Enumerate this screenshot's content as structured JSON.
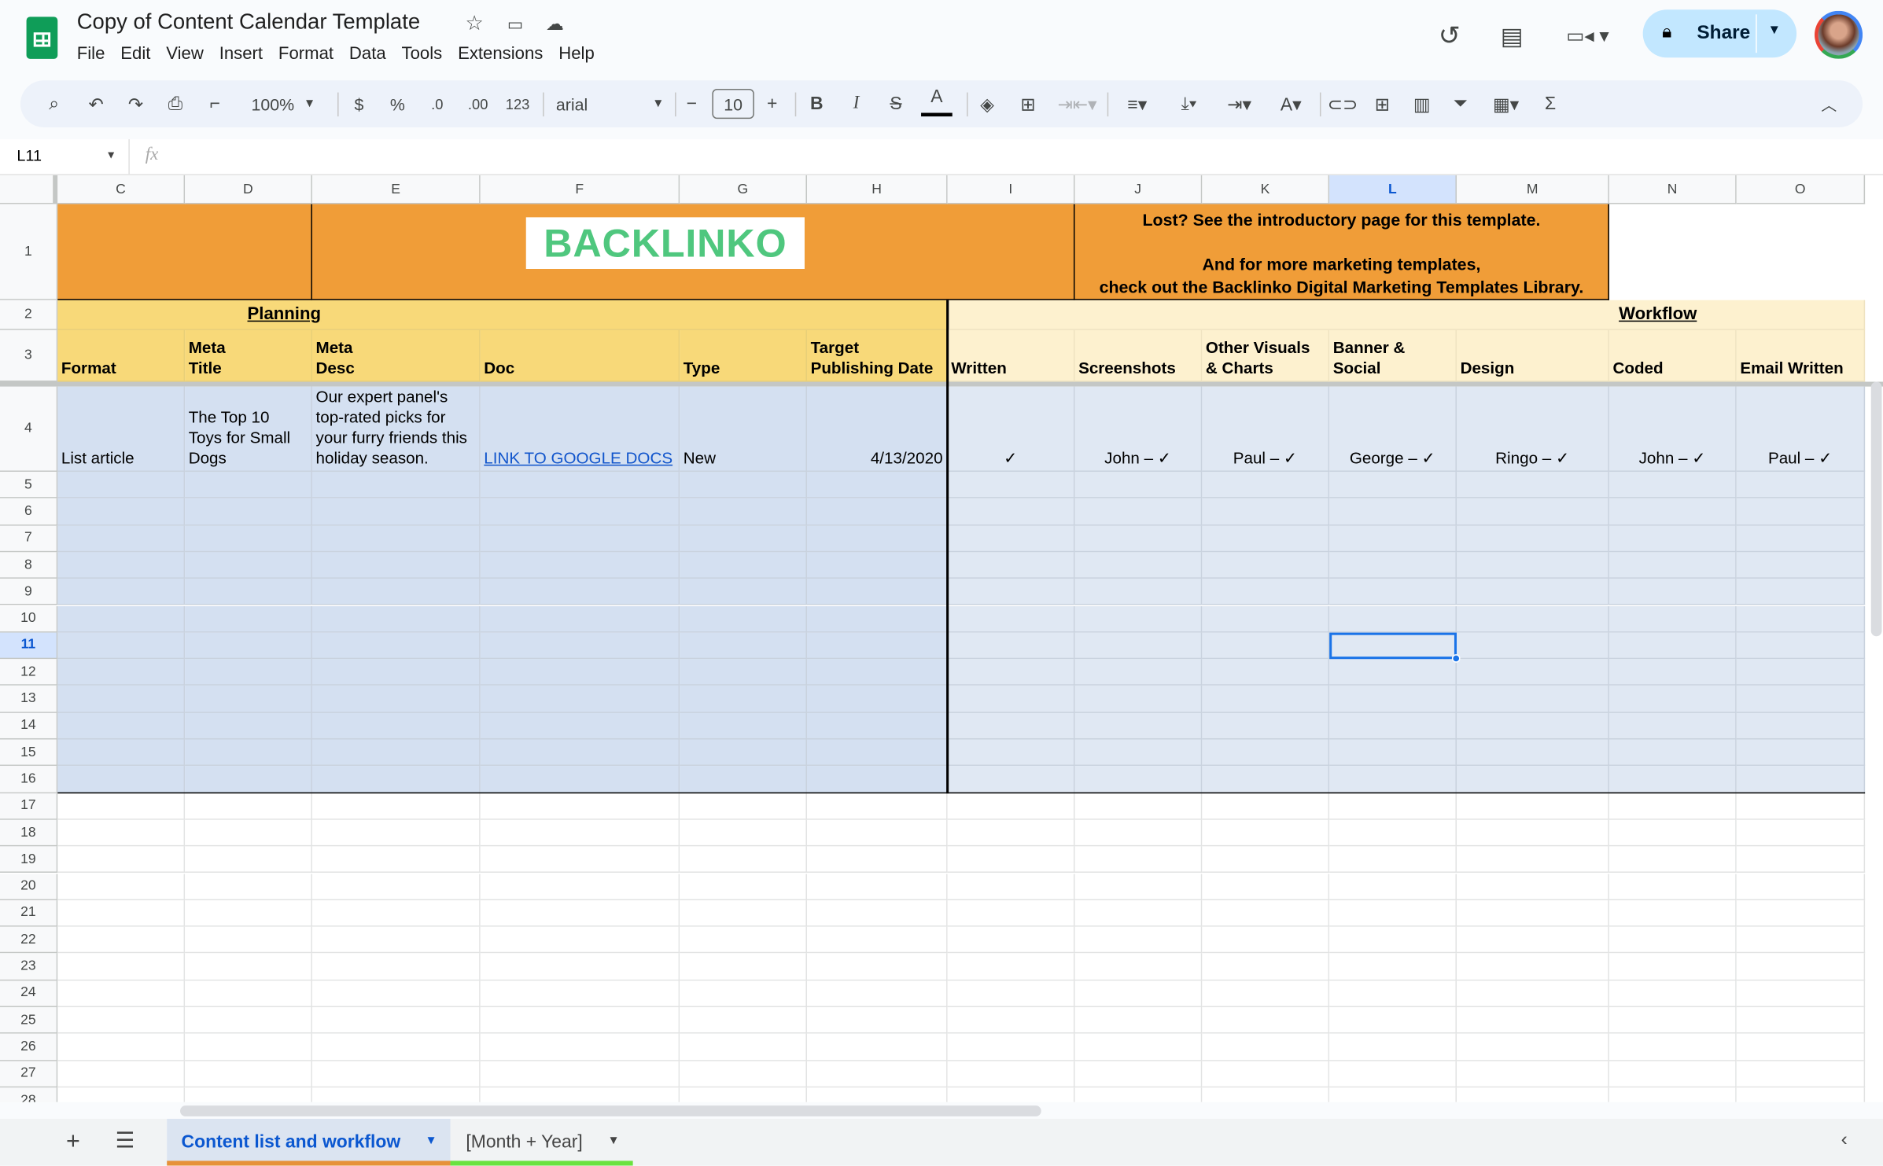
{
  "app": {
    "title": "Copy of Content Calendar Template",
    "menu": [
      "File",
      "Edit",
      "View",
      "Insert",
      "Format",
      "Data",
      "Tools",
      "Extensions",
      "Help"
    ],
    "share_label": "Share",
    "brand_color": "#0f9d58"
  },
  "toolbar": {
    "zoom": "100%",
    "currency": "$",
    "percent": "%",
    "dec_decrease": ".0",
    "dec_increase": ".00",
    "number_format": "123",
    "font": "arial",
    "font_size": "10"
  },
  "formula_bar": {
    "cell_ref": "L11",
    "fx": "fx",
    "value": ""
  },
  "sheet": {
    "columns": [
      "C",
      "D",
      "E",
      "F",
      "G",
      "H",
      "I",
      "J",
      "K",
      "L",
      "M",
      "N",
      "O"
    ],
    "selected_column": "L",
    "selected_row": 11,
    "selected_cell": "L11",
    "row_numbers": [
      1,
      2,
      3,
      4,
      5,
      6,
      7,
      8,
      9,
      10,
      11,
      12,
      13,
      14,
      15,
      16,
      17,
      18,
      19,
      20,
      21,
      22,
      23,
      24,
      25,
      26,
      27,
      28
    ],
    "banner": {
      "logo": "BACKLINKO",
      "line1": "Lost? See the introductory page for this template.",
      "line2": "And for more marketing templates,",
      "line3": "check out the Backlinko Digital Marketing Templates Library."
    },
    "sections": {
      "planning": "Planning",
      "workflow": "Workflow"
    },
    "headers": [
      "Format",
      "Meta\nTitle",
      "Meta\nDesc",
      "Doc",
      "Type",
      "Target\nPublishing Date",
      "Written",
      "Screenshots",
      "Other Visuals\n& Charts",
      "Banner &\nSocial",
      "Design",
      "Coded",
      "Email Written"
    ],
    "row4": [
      "List article",
      "The Top 10\nToys for Small\nDogs",
      "Our expert panel's\ntop-rated picks for\nyour furry friends this\nholiday season.",
      "LINK TO GOOGLE DOCS",
      "New",
      "4/13/2020",
      "✓",
      "John – ✓",
      "Paul – ✓",
      "George –  ✓",
      "Ringo – ✓",
      "John – ✓",
      "Paul – ✓"
    ],
    "colors": {
      "orange": "#f09d38",
      "planning_header": "#f8d979",
      "workflow_header": "#fdf1cf",
      "planning_body": "#d4e0f1",
      "workflow_body": "#e0e8f3",
      "link": "#1155cc"
    }
  },
  "tabs": [
    {
      "label": "Content list and workflow",
      "active": true,
      "color": "#e69138"
    },
    {
      "label": "[Month + Year]",
      "active": false,
      "color": "#6ae23f"
    }
  ]
}
